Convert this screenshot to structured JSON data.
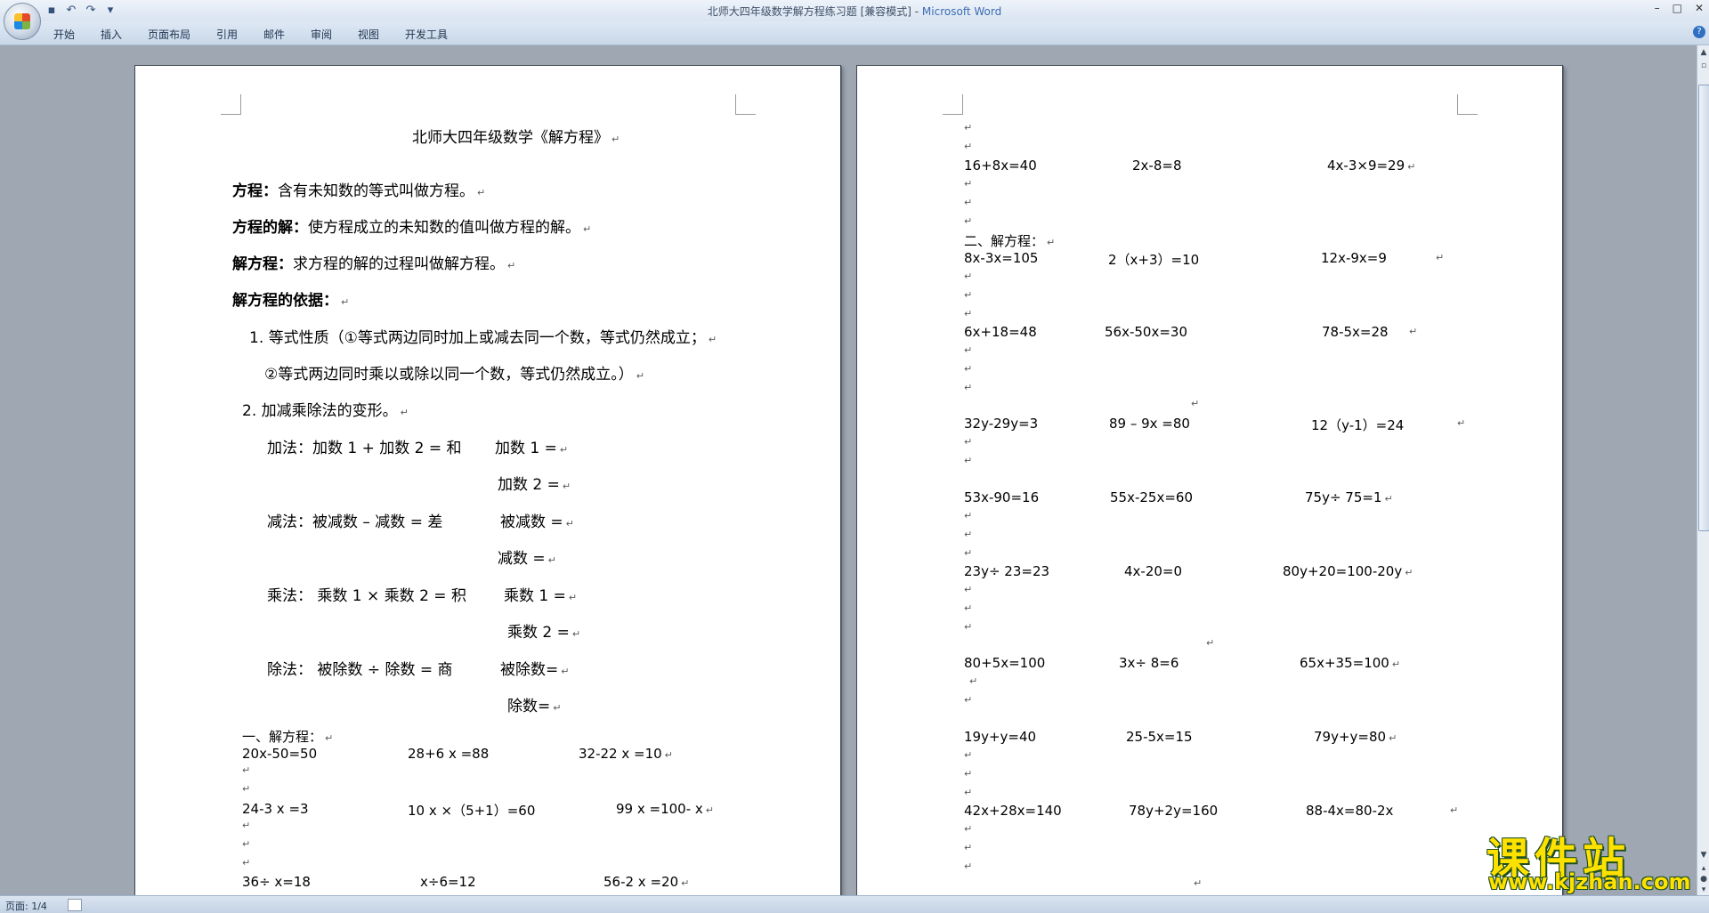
{
  "window": {
    "doc_title": "北师大四年级数学解方程练习题 [兼容模式] - ",
    "app_name": "Microsoft Word"
  },
  "ribbon": {
    "tabs": [
      "开始",
      "插入",
      "页面布局",
      "引用",
      "邮件",
      "审阅",
      "视图",
      "开发工具"
    ]
  },
  "page1": {
    "title": "北师大四年级数学《解方程》",
    "defs": [
      {
        "term": "方程：",
        "text": "含有未知数的等式叫做方程。"
      },
      {
        "term": "方程的解：",
        "text": "使方程成立的未知数的值叫做方程的解。"
      },
      {
        "term": "解方程：",
        "text": "求方程的解的过程叫做解方程。"
      },
      {
        "term": "解方程的依据：",
        "text": ""
      }
    ],
    "rule1_line1": "1.  等式性质（①等式两边同时加上或减去同一个数，等式仍然成立；",
    "rule1_line2": "②等式两边同时乘以或除以同一个数，等式仍然成立。）",
    "rule2": "2.  加减乘除法的变形。",
    "add_label": "加法：加数 1 +  加数 2 =   和",
    "add_r1": "加数 1 =",
    "add_r2": "加数 2 =",
    "sub_label": "减法：被减数 –  减数  =   差",
    "sub_r1": "被减数  =",
    "sub_r2": "减数  =",
    "mul_label": "乘法：  乘数 1 ×  乘数 2 =  积",
    "mul_r1": "乘数 1 =",
    "mul_r2": "乘数 2 =",
    "div_label": "除法：  被除数  ÷  除数  =  商",
    "div_r1": "被除数=",
    "div_r2": "除数=",
    "section1": "一、解方程：",
    "eq_rows": [
      [
        "20x-50=50",
        "28+6 x =88",
        "32-22 x =10"
      ],
      [
        "24-3 x =3",
        "10 x ×（5+1）=60",
        "99 x =100- x"
      ],
      [
        "36÷ x=18",
        "x÷6=12",
        "56-2 x =20"
      ]
    ]
  },
  "page2": {
    "row0": [
      "16+8x=40",
      "2x-8=8",
      "4x-3×9=29"
    ],
    "section2": "二、解方程：",
    "eq_rows": [
      [
        "8x-3x=105",
        "2（x+3）=10",
        "12x-9x=9"
      ],
      [
        "6x+18=48",
        "56x-50x=30",
        "78-5x=28"
      ],
      [
        "32y-29y=3",
        "89 – 9x =80",
        "12（y-1）=24"
      ],
      [
        "53x-90=16",
        "55x-25x=60",
        "75y÷ 75=1"
      ],
      [
        "23y÷ 23=23",
        "4x-20=0",
        "80y+20=100-20y"
      ],
      [
        "80+5x=100",
        "3x÷ 8=6",
        "65x+35=100"
      ],
      [
        "19y+y=40",
        "25-5x=15",
        "79y+y=80"
      ],
      [
        "42x+28x=140",
        "78y+2y=160",
        "88-4x=80-2x"
      ]
    ]
  },
  "para_mark": "↵",
  "status": {
    "page": "页面: 1/4"
  },
  "watermark": {
    "big": "课件站",
    "small": "www.kjzhan.com"
  }
}
